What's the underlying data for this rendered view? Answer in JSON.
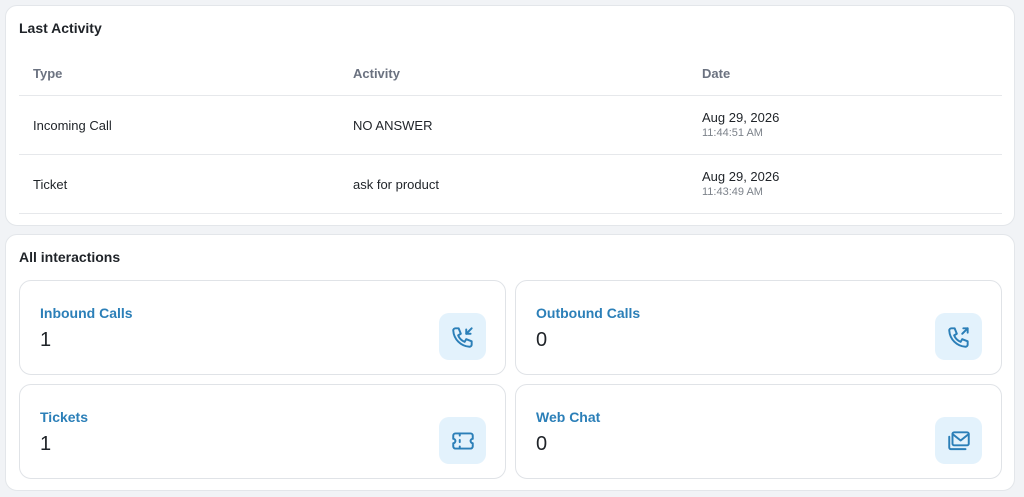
{
  "last_activity": {
    "title": "Last Activity",
    "columns": [
      "Type",
      "Activity",
      "Date"
    ],
    "rows": [
      {
        "type": "Incoming Call",
        "activity": "NO ANSWER",
        "date": "Aug 29, 2026",
        "time": "11:44:51 AM"
      },
      {
        "type": "Ticket",
        "activity": "ask for product",
        "date": "Aug 29, 2026",
        "time": "11:43:49 AM"
      }
    ]
  },
  "interactions": {
    "title": "All interactions",
    "tiles": [
      {
        "label": "Inbound Calls",
        "value": "1",
        "icon": "phone-incoming-icon"
      },
      {
        "label": "Outbound Calls",
        "value": "0",
        "icon": "phone-outgoing-icon"
      },
      {
        "label": "Tickets",
        "value": "1",
        "icon": "ticket-icon"
      },
      {
        "label": "Web Chat",
        "value": "0",
        "icon": "mail-stack-icon"
      }
    ]
  },
  "colors": {
    "accent": "#2b7fb8",
    "icon_bg": "#e3f2fc",
    "card_border": "#e3e6ea",
    "page_bg": "#f1f3f6"
  }
}
